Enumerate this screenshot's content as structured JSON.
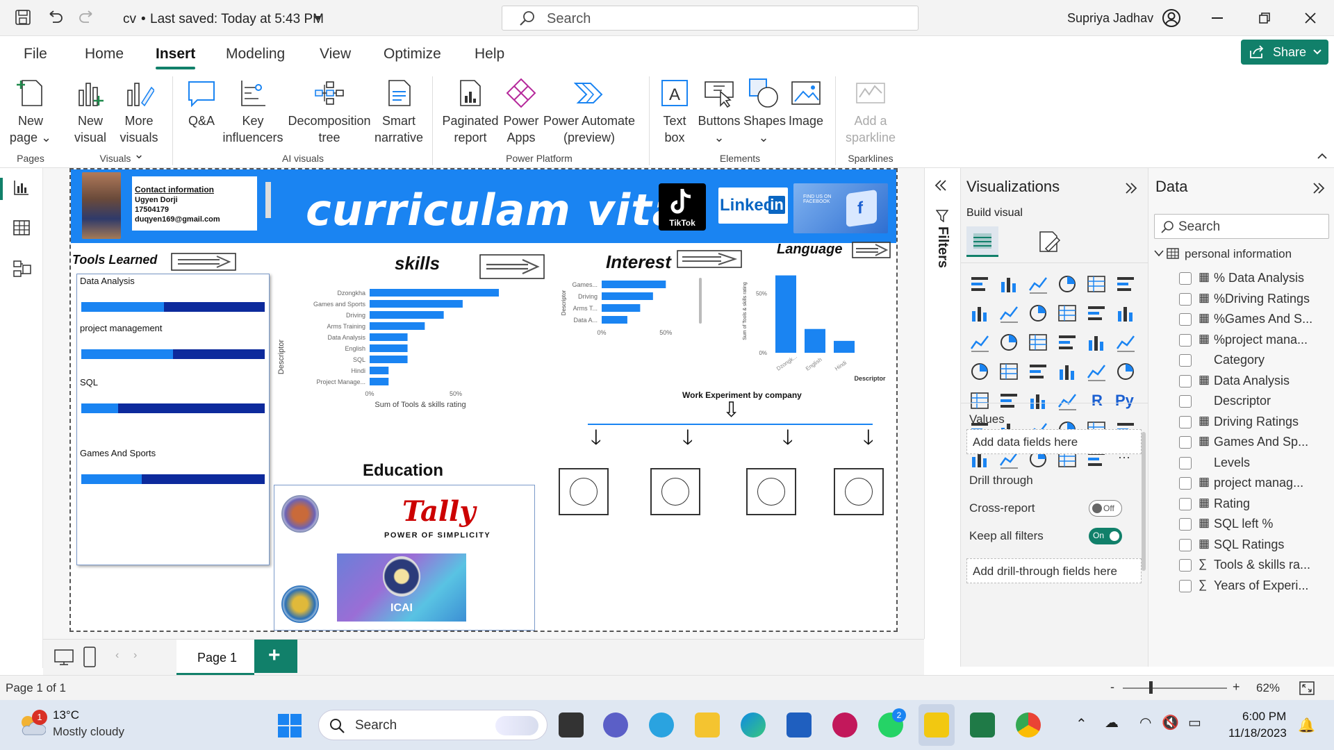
{
  "titlebar": {
    "doc_title": "cv",
    "saved_status": "Last saved: Today at 5:43 PM",
    "search_placeholder": "Search",
    "user": "Supriya Jadhav"
  },
  "tabs": [
    "File",
    "Home",
    "Insert",
    "Modeling",
    "View",
    "Optimize",
    "Help"
  ],
  "active_tab": "Insert",
  "share_label": "Share",
  "ribbon": {
    "new_page": [
      "New",
      "page"
    ],
    "new_visual": [
      "New",
      "visual"
    ],
    "more_visuals": [
      "More",
      "visuals"
    ],
    "qa": "Q&A",
    "key_influencers": [
      "Key",
      "influencers"
    ],
    "decomposition_tree": [
      "Decomposition",
      "tree"
    ],
    "smart_narrative": [
      "Smart",
      "narrative"
    ],
    "paginated_report": [
      "Paginated",
      "report"
    ],
    "power_apps": [
      "Power",
      "Apps"
    ],
    "power_automate": [
      "Power Automate",
      "(preview)"
    ],
    "text_box": [
      "Text",
      "box"
    ],
    "buttons": "Buttons",
    "shapes": "Shapes",
    "image": "Image",
    "sparkline": [
      "Add a",
      "sparkline"
    ],
    "groups": {
      "pages": "Pages",
      "visuals": "Visuals",
      "ai": "AI visuals",
      "platform": "Power Platform",
      "elements": "Elements",
      "sparklines": "Sparklines"
    }
  },
  "report": {
    "contact_title": "Contact information",
    "contact_name": "Ugyen Dorji",
    "contact_phone": "17504179",
    "contact_email": "duqyen169@gmail.com",
    "banner_title": "curriculam vitai",
    "tiktok": "TikTok",
    "linkedin": "Linked",
    "linkedin_in": "in",
    "facebook_text": "FIND US ON FACEBOOK",
    "tools_title": "Tools Learned",
    "skills_title": "skills",
    "interest_title": "Interest",
    "language_title": "Language",
    "education_title": "Education",
    "tally_name": "Tally",
    "tally_tag": "POWER OF SIMPLICITY",
    "icai": "ICAI",
    "work_title": "Work Experiment by company",
    "tools": [
      {
        "name": "Data Analysis",
        "level": 0.45
      },
      {
        "name": "project management",
        "level": 0.5
      },
      {
        "name": "SQL",
        "level": 0.2
      },
      {
        "name": "Games And Sports",
        "level": 0.33
      }
    ]
  },
  "chart_data": [
    {
      "type": "bar",
      "orientation": "horizontal",
      "categories": [
        "Dzongkha",
        "Games and Sports",
        "Driving",
        "Arms Training",
        "Data Analysis",
        "English",
        "SQL",
        "Hindi",
        "Project Manage..."
      ],
      "values": [
        0.75,
        0.54,
        0.43,
        0.32,
        0.22,
        0.22,
        0.22,
        0.11,
        0.11
      ],
      "xlabel": "Sum of Tools & skills rating",
      "ylabel": "Descriptor",
      "x_ticks": [
        "0%",
        "50%"
      ],
      "xlim": [
        0,
        0.75
      ]
    },
    {
      "type": "bar",
      "orientation": "horizontal",
      "categories": [
        "Games...",
        "Driving",
        "Arms T...",
        "Data A..."
      ],
      "values": [
        0.5,
        0.4,
        0.3,
        0.2
      ],
      "ylabel": "Descriptor",
      "x_ticks": [
        "0%",
        "50%"
      ],
      "xlim": [
        0,
        0.65
      ]
    },
    {
      "type": "bar",
      "orientation": "vertical",
      "categories": [
        "Dzongk...",
        "English",
        "Hindi"
      ],
      "values": [
        0.65,
        0.2,
        0.1
      ],
      "ylabel": "Sum of Tools & skills rating",
      "xlabel": "Descriptor",
      "y_ticks": [
        "0%",
        "50%"
      ],
      "ylim": [
        0,
        0.7
      ]
    }
  ],
  "filters_label": "Filters",
  "viz": {
    "title": "Visualizations",
    "build_visual": "Build visual",
    "values_label": "Values",
    "values_placeholder": "Add data fields here",
    "drill_label": "Drill through",
    "cross_report": "Cross-report",
    "cross_state": "Off",
    "keep_filters": "Keep all filters",
    "keep_state": "On",
    "drill_placeholder": "Add drill-through fields here",
    "icons": [
      "stacked-bar",
      "stacked-column",
      "clustered-bar",
      "clustered-column",
      "100-bar",
      "100-column",
      "line",
      "area",
      "stacked-area",
      "line-column",
      "line-clustered",
      "ribbon",
      "waterfall",
      "funnel",
      "scatter",
      "pie",
      "donut",
      "treemap",
      "map",
      "filled-map",
      "azure-map",
      "gauge",
      "card",
      "multirow-card",
      "kpi",
      "slicer",
      "table",
      "matrix",
      "r-visual",
      "python-visual",
      "key-influencers",
      "decomposition",
      "qa",
      "narrative",
      "metrics",
      "paginated",
      "card-new",
      "narrative-new",
      "arcgis",
      "power-apps",
      "power-automate",
      "more"
    ],
    "r_label": "R",
    "py_label": "Py",
    "more_label": "···"
  },
  "data_pane": {
    "title": "Data",
    "search_placeholder": "Search",
    "table": "personal information",
    "fields": [
      {
        "name": "% Data Analysis",
        "icon": "calc"
      },
      {
        "name": "%Driving Ratings",
        "icon": "calc"
      },
      {
        "name": "%Games And S...",
        "icon": "calc"
      },
      {
        "name": "%project mana...",
        "icon": "calc"
      },
      {
        "name": "Category",
        "icon": ""
      },
      {
        "name": "Data Analysis",
        "icon": "calc"
      },
      {
        "name": "Descriptor",
        "icon": ""
      },
      {
        "name": "Driving Ratings",
        "icon": "calc"
      },
      {
        "name": "Games And Sp...",
        "icon": "calc"
      },
      {
        "name": "Levels",
        "icon": ""
      },
      {
        "name": "project manag...",
        "icon": "calc"
      },
      {
        "name": "Rating",
        "icon": "calc"
      },
      {
        "name": "SQL left %",
        "icon": "calc"
      },
      {
        "name": "SQL Ratings",
        "icon": "calc"
      },
      {
        "name": "Tools & skills ra...",
        "icon": "sigma"
      },
      {
        "name": "Years of Experi...",
        "icon": "sigma"
      }
    ]
  },
  "page_tab": "Page 1",
  "status": {
    "page": "Page 1 of 1",
    "zoom": "62%"
  },
  "taskbar": {
    "temp": "13°C",
    "weather": "Mostly cloudy",
    "weather_badge": "1",
    "search": "Search",
    "whatsapp_badge": "2",
    "time": "6:00 PM",
    "date": "11/18/2023"
  }
}
